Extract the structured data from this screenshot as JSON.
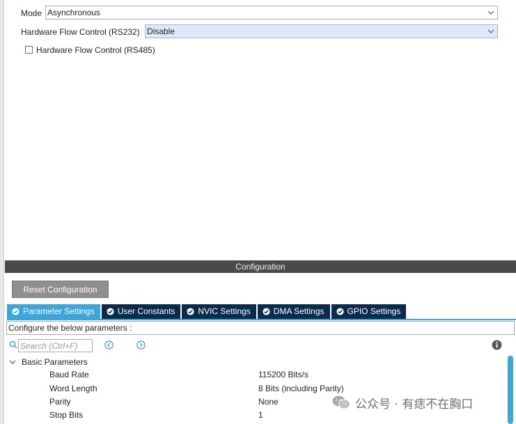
{
  "mode_section": {
    "mode_label": "Mode",
    "mode_value": "Asynchronous",
    "flow_rs232_label": "Hardware Flow Control (RS232)",
    "flow_rs232_value": "Disable",
    "flow_rs485_label": "Hardware Flow Control (RS485)",
    "flow_rs485_checked": false
  },
  "configuration": {
    "header": "Configuration",
    "reset_label": "Reset Configuration",
    "tabs": [
      {
        "label": "Parameter Settings",
        "active": true
      },
      {
        "label": "User Constants",
        "active": false
      },
      {
        "label": "NVIC Settings",
        "active": false
      },
      {
        "label": "DMA Settings",
        "active": false
      },
      {
        "label": "GPIO Settings",
        "active": false
      }
    ],
    "hint": "Configure the below parameters :",
    "search_placeholder": "Search (Ctrl+F)",
    "group": "Basic Parameters",
    "params": [
      {
        "name": "Baud Rate",
        "value": "115200 Bits/s"
      },
      {
        "name": "Word Length",
        "value": "8 Bits (including Parity)"
      },
      {
        "name": "Parity",
        "value": "None"
      },
      {
        "name": "Stop Bits",
        "value": "1"
      }
    ]
  },
  "watermark": "公众号 · 有痣不在胸口",
  "colors": {
    "tab_active": "#3ba6dc",
    "tab_inactive": "#0b2b4d",
    "header_bg": "#4a4a4a",
    "button_bg": "#8f8f8f"
  },
  "icons": {
    "tab_icon": "check-circle-icon",
    "search": "search-icon",
    "prev": "prev-circle-icon",
    "next": "next-circle-icon",
    "info": "info-icon",
    "expand": "chevron-down-icon",
    "dropdown": "chevron-down-icon"
  }
}
